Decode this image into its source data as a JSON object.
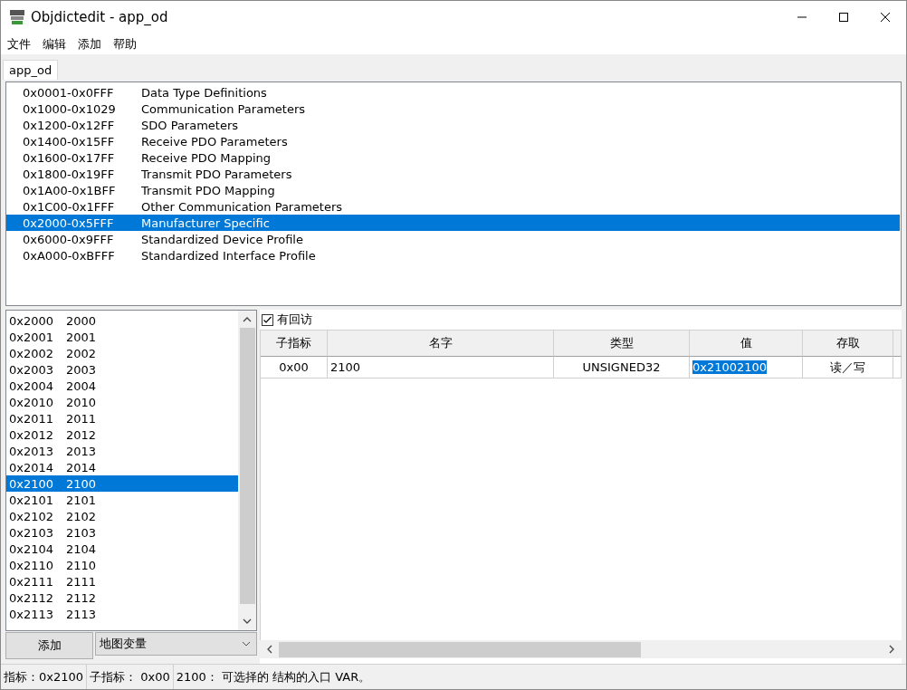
{
  "window": {
    "title": "Objdictedit - app_od"
  },
  "menu": [
    "文件",
    "编辑",
    "添加",
    "帮助"
  ],
  "tabs": [
    {
      "label": "app_od",
      "selected": true
    }
  ],
  "ranges": [
    {
      "range": "0x0001-0x0FFF",
      "name": "Data Type Definitions",
      "selected": false
    },
    {
      "range": "0x1000-0x1029",
      "name": "Communication Parameters",
      "selected": false
    },
    {
      "range": "0x1200-0x12FF",
      "name": "SDO Parameters",
      "selected": false
    },
    {
      "range": "0x1400-0x15FF",
      "name": "Receive PDO Parameters",
      "selected": false
    },
    {
      "range": "0x1600-0x17FF",
      "name": "Receive PDO Mapping",
      "selected": false
    },
    {
      "range": "0x1800-0x19FF",
      "name": "Transmit PDO Parameters",
      "selected": false
    },
    {
      "range": "0x1A00-0x1BFF",
      "name": "Transmit PDO Mapping",
      "selected": false
    },
    {
      "range": "0x1C00-0x1FFF",
      "name": "Other Communication Parameters",
      "selected": false
    },
    {
      "range": "0x2000-0x5FFF",
      "name": "Manufacturer Specific",
      "selected": true
    },
    {
      "range": "0x6000-0x9FFF",
      "name": "Standardized Device Profile",
      "selected": false
    },
    {
      "range": "0xA000-0xBFFF",
      "name": "Standardized Interface Profile",
      "selected": false
    }
  ],
  "indexes": [
    {
      "index": "0x2000",
      "name": "2000",
      "selected": false
    },
    {
      "index": "0x2001",
      "name": "2001",
      "selected": false
    },
    {
      "index": "0x2002",
      "name": "2002",
      "selected": false
    },
    {
      "index": "0x2003",
      "name": "2003",
      "selected": false
    },
    {
      "index": "0x2004",
      "name": "2004",
      "selected": false
    },
    {
      "index": "0x2010",
      "name": "2010",
      "selected": false
    },
    {
      "index": "0x2011",
      "name": "2011",
      "selected": false
    },
    {
      "index": "0x2012",
      "name": "2012",
      "selected": false
    },
    {
      "index": "0x2013",
      "name": "2013",
      "selected": false
    },
    {
      "index": "0x2014",
      "name": "2014",
      "selected": false
    },
    {
      "index": "0x2100",
      "name": "2100",
      "selected": true
    },
    {
      "index": "0x2101",
      "name": "2101",
      "selected": false
    },
    {
      "index": "0x2102",
      "name": "2102",
      "selected": false
    },
    {
      "index": "0x2103",
      "name": "2103",
      "selected": false
    },
    {
      "index": "0x2104",
      "name": "2104",
      "selected": false
    },
    {
      "index": "0x2110",
      "name": "2110",
      "selected": false
    },
    {
      "index": "0x2111",
      "name": "2111",
      "selected": false
    },
    {
      "index": "0x2112",
      "name": "2112",
      "selected": false
    },
    {
      "index": "0x2113",
      "name": "2113",
      "selected": false
    }
  ],
  "add_button": "添加",
  "type_combo": {
    "value": "地图变量"
  },
  "callback_checkbox": {
    "label": "有回访",
    "checked": true
  },
  "table": {
    "columns": [
      "子指标",
      "名字",
      "类型",
      "值",
      "存取"
    ],
    "rows": [
      {
        "cells": [
          {
            "text": "0x00",
            "selected": false
          },
          {
            "text": "2100",
            "selected": false
          },
          {
            "text": "UNSIGNED32",
            "selected": false
          },
          {
            "text": "0x21002100",
            "selected": true
          },
          {
            "text": "读／写",
            "selected": false
          }
        ]
      }
    ]
  },
  "status_bar": [
    "指标：0x2100",
    "子指标：  0x00",
    "2100：  可选择的 结构的入口 VAR。"
  ]
}
